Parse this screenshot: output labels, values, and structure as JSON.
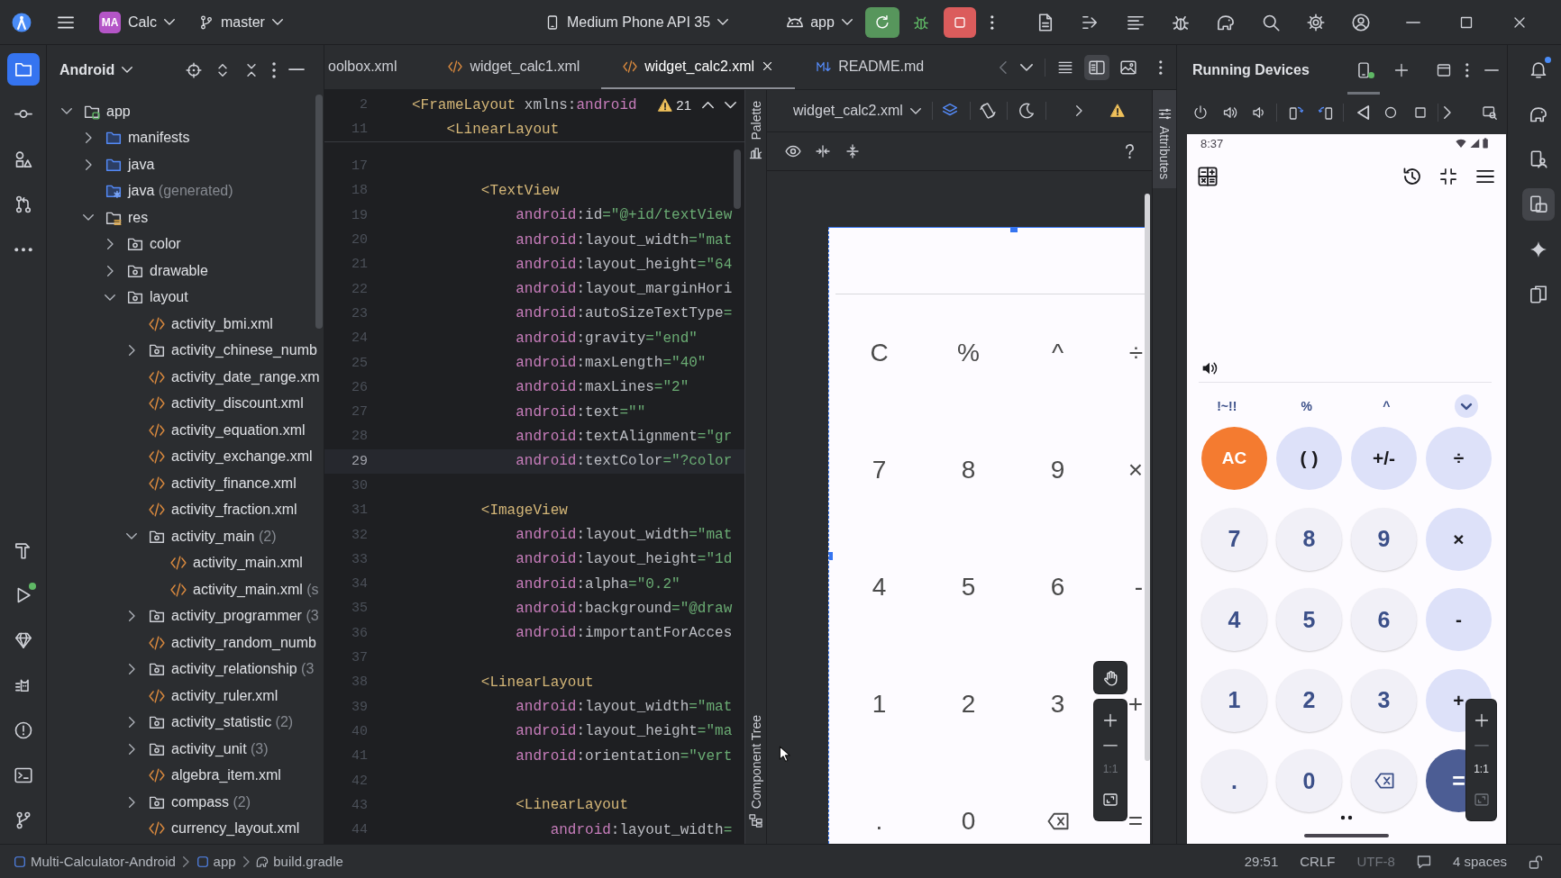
{
  "title_bar": {
    "project_badge": "MA",
    "project": "Calc",
    "branch": "master",
    "device": "Medium Phone API 35",
    "run_config": "app"
  },
  "left_strip": {
    "top": [
      {
        "kind": "project",
        "selected": true
      },
      {
        "kind": "commit",
        "selected": false
      },
      {
        "kind": "structure",
        "selected": false
      },
      {
        "kind": "pulls",
        "selected": false
      },
      {
        "kind": "more",
        "selected": false
      }
    ],
    "bottom": [
      {
        "kind": "build",
        "selected": false
      },
      {
        "kind": "run",
        "selected": false
      },
      {
        "kind": "gem",
        "selected": false
      },
      {
        "kind": "logcat",
        "selected": false
      },
      {
        "kind": "problems",
        "selected": false
      },
      {
        "kind": "terminal",
        "selected": false
      },
      {
        "kind": "git",
        "selected": false
      }
    ]
  },
  "project_panel": {
    "view": "Android",
    "tree": [
      {
        "label": "app",
        "kind": "module",
        "expanded": true,
        "children": [
          {
            "label": "manifests",
            "kind": "source",
            "expanded": false
          },
          {
            "label": "java",
            "kind": "source",
            "expanded": false
          },
          {
            "label": "java",
            "note": "(generated)",
            "kind": "generated"
          },
          {
            "label": "res",
            "kind": "resources",
            "expanded": true,
            "children": [
              {
                "label": "color",
                "kind": "resdir",
                "expanded": false
              },
              {
                "label": "drawable",
                "kind": "resdir",
                "expanded": false
              },
              {
                "label": "layout",
                "kind": "resdir",
                "expanded": true,
                "children": [
                  {
                    "label": "activity_bmi.xml",
                    "kind": "xml"
                  },
                  {
                    "label": "activity_chinese_numb",
                    "kind": "resdir",
                    "expanded": false
                  },
                  {
                    "label": "activity_date_range.xm",
                    "kind": "xml"
                  },
                  {
                    "label": "activity_discount.xml",
                    "kind": "xml"
                  },
                  {
                    "label": "activity_equation.xml",
                    "kind": "xml"
                  },
                  {
                    "label": "activity_exchange.xml",
                    "kind": "xml"
                  },
                  {
                    "label": "activity_finance.xml",
                    "kind": "xml"
                  },
                  {
                    "label": "activity_fraction.xml",
                    "kind": "xml"
                  },
                  {
                    "label": "activity_main",
                    "note": "(2)",
                    "kind": "resdir",
                    "expanded": true,
                    "children": [
                      {
                        "label": "activity_main.xml",
                        "kind": "xml"
                      },
                      {
                        "label": "activity_main.xml",
                        "note": "(s",
                        "kind": "xml"
                      }
                    ]
                  },
                  {
                    "label": "activity_programmer",
                    "note": "(3",
                    "kind": "resdir",
                    "expanded": false
                  },
                  {
                    "label": "activity_random_numb",
                    "kind": "xml"
                  },
                  {
                    "label": "activity_relationship",
                    "note": "(3",
                    "kind": "resdir",
                    "expanded": false
                  },
                  {
                    "label": "activity_ruler.xml",
                    "kind": "xml"
                  },
                  {
                    "label": "activity_statistic",
                    "note": "(2)",
                    "kind": "resdir",
                    "expanded": false
                  },
                  {
                    "label": "activity_unit",
                    "note": "(3)",
                    "kind": "resdir",
                    "expanded": false
                  },
                  {
                    "label": "algebra_item.xml",
                    "kind": "xml"
                  },
                  {
                    "label": "compass",
                    "note": "(2)",
                    "kind": "resdir",
                    "expanded": false
                  },
                  {
                    "label": "currency_layout.xml",
                    "kind": "xml"
                  }
                ]
              }
            ]
          }
        ]
      }
    ]
  },
  "editor": {
    "tabs": [
      {
        "label": "oolbox.xml",
        "kind": "clipped",
        "selected": false
      },
      {
        "label": "widget_calc1.xml",
        "kind": "xml",
        "selected": false
      },
      {
        "label": "widget_calc2.xml",
        "kind": "xml",
        "selected": true
      },
      {
        "label": "README.md",
        "kind": "markdown",
        "selected": false
      }
    ],
    "view_modes": [
      {
        "kind": "code",
        "selected": false
      },
      {
        "kind": "split",
        "selected": true
      },
      {
        "kind": "design",
        "selected": false
      }
    ],
    "warning_count": "21",
    "sticky_lines": [
      {
        "number": "2",
        "code": [
          {
            "kind": "tag",
            "text": "<FrameLayout"
          },
          {
            "kind": "attr",
            "text": " xmlns:"
          },
          {
            "kind": "ns",
            "text": "android"
          }
        ]
      },
      {
        "number": "11",
        "code": [
          {
            "kind": "tag",
            "text": "    <LinearLayout"
          }
        ]
      }
    ],
    "lines": [
      {
        "number": "17",
        "current": false
      },
      {
        "number": "18",
        "current": false,
        "code": [
          {
            "kind": "tag",
            "text": "        <TextView"
          }
        ]
      },
      {
        "number": "19",
        "current": false,
        "code": [
          {
            "kind": "ns",
            "text": "            android"
          },
          {
            "kind": "attr",
            "text": ":id"
          },
          {
            "kind": "value",
            "text": "=\"@+id/textView"
          }
        ]
      },
      {
        "number": "20",
        "current": false,
        "code": [
          {
            "kind": "ns",
            "text": "            android"
          },
          {
            "kind": "attr",
            "text": ":layout_width"
          },
          {
            "kind": "value",
            "text": "=\"mat"
          }
        ]
      },
      {
        "number": "21",
        "current": false,
        "code": [
          {
            "kind": "ns",
            "text": "            android"
          },
          {
            "kind": "attr",
            "text": ":layout_height"
          },
          {
            "kind": "value",
            "text": "=\"64"
          }
        ]
      },
      {
        "number": "22",
        "current": false,
        "code": [
          {
            "kind": "ns",
            "text": "            android"
          },
          {
            "kind": "attr",
            "text": ":layout_marginHori"
          }
        ]
      },
      {
        "number": "23",
        "current": false,
        "code": [
          {
            "kind": "ns",
            "text": "            android"
          },
          {
            "kind": "attr",
            "text": ":autoSizeTextType"
          },
          {
            "kind": "value",
            "text": "="
          }
        ]
      },
      {
        "number": "24",
        "current": false,
        "code": [
          {
            "kind": "ns",
            "text": "            android"
          },
          {
            "kind": "attr",
            "text": ":gravity"
          },
          {
            "kind": "value",
            "text": "=\"end\""
          }
        ]
      },
      {
        "number": "25",
        "current": false,
        "code": [
          {
            "kind": "ns",
            "text": "            android"
          },
          {
            "kind": "attr",
            "text": ":maxLength"
          },
          {
            "kind": "value",
            "text": "=\"40\""
          }
        ]
      },
      {
        "number": "26",
        "current": false,
        "code": [
          {
            "kind": "ns",
            "text": "            android"
          },
          {
            "kind": "attr",
            "text": ":maxLines"
          },
          {
            "kind": "value",
            "text": "=\"2\""
          }
        ]
      },
      {
        "number": "27",
        "current": false,
        "code": [
          {
            "kind": "ns",
            "text": "            android"
          },
          {
            "kind": "attr",
            "text": ":text"
          },
          {
            "kind": "value",
            "text": "=\"\""
          }
        ]
      },
      {
        "number": "28",
        "current": false,
        "code": [
          {
            "kind": "ns",
            "text": "            android"
          },
          {
            "kind": "attr",
            "text": ":textAlignment"
          },
          {
            "kind": "value",
            "text": "=\"gr"
          }
        ]
      },
      {
        "number": "29",
        "current": true,
        "code": [
          {
            "kind": "ns",
            "text": "            android"
          },
          {
            "kind": "attr",
            "text": ":textColor"
          },
          {
            "kind": "value",
            "text": "=\"?color"
          }
        ]
      },
      {
        "number": "30",
        "current": false
      },
      {
        "number": "31",
        "current": false,
        "code": [
          {
            "kind": "tag",
            "text": "        <ImageView"
          }
        ]
      },
      {
        "number": "32",
        "current": false,
        "code": [
          {
            "kind": "ns",
            "text": "            android"
          },
          {
            "kind": "attr",
            "text": ":layout_width"
          },
          {
            "kind": "value",
            "text": "=\"mat"
          }
        ]
      },
      {
        "number": "33",
        "current": false,
        "code": [
          {
            "kind": "ns",
            "text": "            android"
          },
          {
            "kind": "attr",
            "text": ":layout_height"
          },
          {
            "kind": "value",
            "text": "=\"1d"
          }
        ]
      },
      {
        "number": "34",
        "current": false,
        "code": [
          {
            "kind": "ns",
            "text": "            android"
          },
          {
            "kind": "attr",
            "text": ":alpha"
          },
          {
            "kind": "value",
            "text": "=\"0.2\""
          }
        ]
      },
      {
        "number": "35",
        "current": false,
        "code": [
          {
            "kind": "ns",
            "text": "            android"
          },
          {
            "kind": "attr",
            "text": ":background"
          },
          {
            "kind": "value",
            "text": "=\"@draw"
          }
        ]
      },
      {
        "number": "36",
        "current": false,
        "code": [
          {
            "kind": "ns",
            "text": "            android"
          },
          {
            "kind": "attr",
            "text": ":importantForAcces"
          }
        ]
      },
      {
        "number": "37",
        "current": false
      },
      {
        "number": "38",
        "current": false,
        "code": [
          {
            "kind": "tag",
            "text": "        <LinearLayout"
          }
        ]
      },
      {
        "number": "39",
        "current": false,
        "code": [
          {
            "kind": "ns",
            "text": "            android"
          },
          {
            "kind": "attr",
            "text": ":layout_width"
          },
          {
            "kind": "value",
            "text": "=\"mat"
          }
        ]
      },
      {
        "number": "40",
        "current": false,
        "code": [
          {
            "kind": "ns",
            "text": "            android"
          },
          {
            "kind": "attr",
            "text": ":layout_height"
          },
          {
            "kind": "value",
            "text": "=\"ma"
          }
        ]
      },
      {
        "number": "41",
        "current": false,
        "code": [
          {
            "kind": "ns",
            "text": "            android"
          },
          {
            "kind": "attr",
            "text": ":orientation"
          },
          {
            "kind": "value",
            "text": "=\"vert"
          }
        ]
      },
      {
        "number": "42",
        "current": false
      },
      {
        "number": "43",
        "current": false,
        "code": [
          {
            "kind": "tag",
            "text": "            <LinearLayout"
          }
        ]
      },
      {
        "number": "44",
        "current": false,
        "code": [
          {
            "kind": "ns",
            "text": "                android"
          },
          {
            "kind": "attr",
            "text": ":layout_width"
          },
          {
            "kind": "value",
            "text": "="
          }
        ]
      }
    ]
  },
  "palette_strip": {
    "top": "Palette",
    "bottom": "Component Tree"
  },
  "design": {
    "file": "widget_calc2.xml",
    "keys": [
      [
        {
          "kind": "text",
          "label": "C"
        },
        {
          "kind": "text",
          "label": "%"
        },
        {
          "kind": "text",
          "label": "^"
        },
        {
          "kind": "text",
          "label": "÷"
        }
      ],
      [
        {
          "kind": "text",
          "label": "7"
        },
        {
          "kind": "text",
          "label": "8"
        },
        {
          "kind": "text",
          "label": "9"
        },
        {
          "kind": "text",
          "label": "×"
        }
      ],
      [
        {
          "kind": "text",
          "label": "4"
        },
        {
          "kind": "text",
          "label": "5"
        },
        {
          "kind": "text",
          "label": "6"
        },
        {
          "kind": "text",
          "label": "-"
        }
      ],
      [
        {
          "kind": "text",
          "label": "1"
        },
        {
          "kind": "text",
          "label": "2"
        },
        {
          "kind": "text",
          "label": "3"
        },
        {
          "kind": "text",
          "label": "+"
        }
      ],
      [
        {
          "kind": "text",
          "label": "."
        },
        {
          "kind": "text",
          "label": "0"
        },
        {
          "kind": "backspace"
        },
        {
          "kind": "text",
          "label": "="
        }
      ]
    ],
    "zoom_reset": {
      "label": "1:1",
      "disabled": true
    }
  },
  "attributes_strip": {
    "label": "Attributes",
    "selected": true
  },
  "running_devices": {
    "title": "Running Devices",
    "screen": {
      "time": "8:37",
      "functions": [
        {
          "kind": "text",
          "label": "!~!!"
        },
        {
          "kind": "text",
          "label": "%"
        },
        {
          "kind": "text",
          "label": "^"
        },
        {
          "kind": "expand"
        }
      ],
      "keys": [
        {
          "kind": "clear",
          "label": "AC"
        },
        {
          "kind": "operator",
          "label": "( )"
        },
        {
          "kind": "operator",
          "label": "+/-"
        },
        {
          "kind": "operator",
          "label": "÷"
        },
        {
          "kind": "digit",
          "label": "7"
        },
        {
          "kind": "digit",
          "label": "8"
        },
        {
          "kind": "digit",
          "label": "9"
        },
        {
          "kind": "operator",
          "label": "×"
        },
        {
          "kind": "digit",
          "label": "4"
        },
        {
          "kind": "digit",
          "label": "5"
        },
        {
          "kind": "digit",
          "label": "6"
        },
        {
          "kind": "operator",
          "label": "-"
        },
        {
          "kind": "digit",
          "label": "1"
        },
        {
          "kind": "digit",
          "label": "2"
        },
        {
          "kind": "digit",
          "label": "3"
        },
        {
          "kind": "operator",
          "label": "+"
        },
        {
          "kind": "digit",
          "label": "."
        },
        {
          "kind": "digit",
          "label": "0"
        },
        {
          "kind": "backspace"
        },
        {
          "kind": "equals",
          "label": "="
        }
      ]
    },
    "zoom_reset": {
      "label": "1:1",
      "disabled": false
    }
  },
  "right_strip": [
    {
      "kind": "notifications",
      "selected": false
    },
    {
      "kind": "gradle",
      "selected": false
    },
    {
      "kind": "devices",
      "selected": false
    },
    {
      "kind": "running",
      "selected": true
    },
    {
      "kind": "assistant",
      "selected": false
    },
    {
      "kind": "mirroring",
      "selected": false
    }
  ],
  "status_bar": {
    "breadcrumbs": [
      {
        "kind": "module",
        "label": "Multi-Calculator-Android"
      },
      {
        "kind": "module",
        "label": "app"
      },
      {
        "kind": "gradle",
        "label": "build.gradle"
      }
    ],
    "caret_position": "29:51",
    "line_separator": "CRLF",
    "encoding": {
      "label": "UTF-8",
      "disabled": true
    },
    "indent": "4 spaces"
  }
}
